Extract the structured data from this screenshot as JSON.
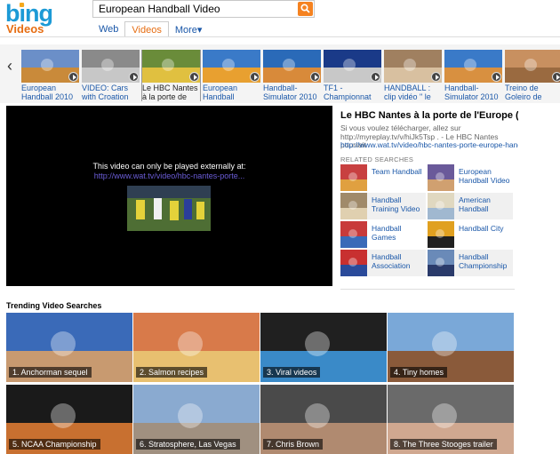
{
  "header": {
    "logo": "bing",
    "section_title": "Videos",
    "search_value": "European Handball Video",
    "scopes": [
      {
        "label": "Web",
        "active": false
      },
      {
        "label": "Videos",
        "active": true
      },
      {
        "label": "More▾",
        "active": false
      }
    ]
  },
  "filmstrip": {
    "prev_arrow": "‹",
    "items": [
      {
        "caption": "European Handball 2010",
        "selected": false,
        "colors": [
          "#6b8fc8",
          "#c98a3a"
        ]
      },
      {
        "caption": "VIDEO: Cars with Croation number",
        "selected": false,
        "colors": [
          "#8a8a8a",
          "#c7c7c7"
        ]
      },
      {
        "caption": "Le HBC Nantes à la porte de",
        "selected": true,
        "colors": [
          "#6a8c3a",
          "#e0c040"
        ]
      },
      {
        "caption": "European Handball",
        "selected": false,
        "colors": [
          "#3a7ac8",
          "#e8a030"
        ]
      },
      {
        "caption": "Handball-Simulator 2010 -",
        "selected": false,
        "colors": [
          "#2a6ab8",
          "#d88a3a"
        ]
      },
      {
        "caption": "TF1 - Championnat",
        "selected": false,
        "colors": [
          "#1a3a88",
          "#c8c8c8"
        ]
      },
      {
        "caption": "HANDBALL : clip vidéo \" le groupe",
        "selected": false,
        "colors": [
          "#a08060",
          "#d8c0a0"
        ]
      },
      {
        "caption": "Handball-Simulator 2010 -",
        "selected": false,
        "colors": [
          "#3a7ac8",
          "#d89040"
        ]
      },
      {
        "caption": "Treino de Goleiro de Handebol de",
        "selected": false,
        "colors": [
          "#c89060",
          "#9a6a40"
        ]
      }
    ]
  },
  "player": {
    "message": "This video can only be played externally at:",
    "url": "http://www.wat.tv/video/hbc-nantes-porte..."
  },
  "info": {
    "title": "Le HBC Nantes à la porte de l'Europe (Hand...",
    "description": "Si vous voulez télécharger, allez sur http://myreplay.tv/v/hiJk5Tsp . - Le HBC Nantes pourrait",
    "link": "http://www.wat.tv/video/hbc-nantes-porte-europe-hand..."
  },
  "related": {
    "heading": "RELATED SEARCHES",
    "items": [
      {
        "label": "Team Handball",
        "colors": [
          "#c84040",
          "#e0a040"
        ]
      },
      {
        "label": "European Handball Video",
        "colors": [
          "#6a5a9a",
          "#d0a070"
        ]
      },
      {
        "label": "Handball Training Video",
        "colors": [
          "#a08a6a",
          "#e0d0b0"
        ]
      },
      {
        "label": "American Handball",
        "colors": [
          "#e0d8c0",
          "#a0b8d0"
        ]
      },
      {
        "label": "Handball Games",
        "colors": [
          "#c83a3a",
          "#3a6ab8"
        ]
      },
      {
        "label": "Handball City",
        "colors": [
          "#e0a020",
          "#202020"
        ]
      },
      {
        "label": "Handball Association",
        "colors": [
          "#c83030",
          "#2a4a9a"
        ]
      },
      {
        "label": "Handball Championship",
        "colors": [
          "#6a8ab8",
          "#2a3a6a"
        ]
      }
    ]
  },
  "trending": {
    "heading": "Trending Video Searches",
    "items": [
      {
        "label": "1. Anchorman sequel",
        "colors": [
          "#3a6ab8",
          "#c89a70"
        ]
      },
      {
        "label": "2. Salmon recipes",
        "colors": [
          "#d87a4a",
          "#e8c070"
        ]
      },
      {
        "label": "3. Viral videos",
        "colors": [
          "#202020",
          "#3a8ac8"
        ]
      },
      {
        "label": "4. Tiny homes",
        "colors": [
          "#7aa8d8",
          "#8a5a3a"
        ]
      },
      {
        "label": "5. NCAA Championship",
        "colors": [
          "#1a1a1a",
          "#c87030"
        ]
      },
      {
        "label": "6. Stratosphere, Las Vegas",
        "colors": [
          "#8aaad0",
          "#a09080"
        ]
      },
      {
        "label": "7. Chris Brown",
        "colors": [
          "#4a4a4a",
          "#b08a70"
        ]
      },
      {
        "label": "8. The Three Stooges trailer",
        "colors": [
          "#6a6a6a",
          "#d0a890"
        ]
      }
    ]
  }
}
